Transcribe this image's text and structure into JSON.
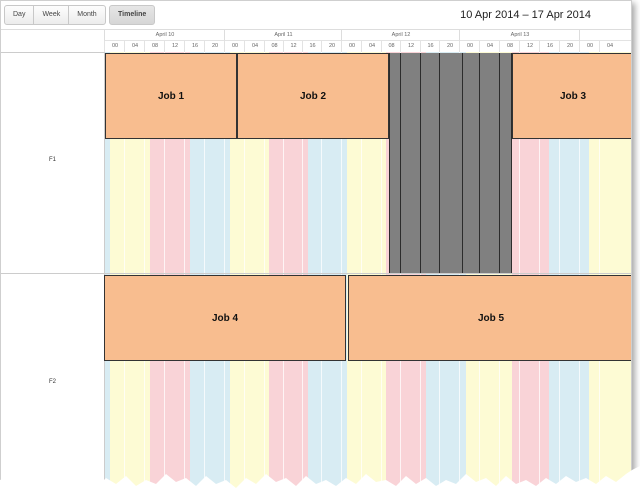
{
  "toolbar": {
    "views": [
      "Day",
      "Week",
      "Month"
    ],
    "timeline_label": "Timeline",
    "date_range": "10 Apr 2014 – 17 Apr 2014"
  },
  "timeline": {
    "days": [
      "April 10",
      "April 11",
      "April 12",
      "April 13"
    ],
    "hours": [
      "00",
      "04",
      "08",
      "12",
      "16",
      "20"
    ]
  },
  "resources": [
    "F1",
    "F2"
  ],
  "jobs": [
    {
      "name": "Job 1",
      "resource": "F1"
    },
    {
      "name": "Job 2",
      "resource": "F1"
    },
    {
      "name": "Job 3",
      "resource": "F1"
    },
    {
      "name": "Job 4",
      "resource": "F2"
    },
    {
      "name": "Job 5",
      "resource": "F2"
    }
  ],
  "colors": {
    "job": "#f8bd8f",
    "blocked": "#808080",
    "shift_yellow": "#fdfbd4",
    "shift_pink": "#f9d3d7",
    "shift_blue": "#d8ecf3"
  }
}
